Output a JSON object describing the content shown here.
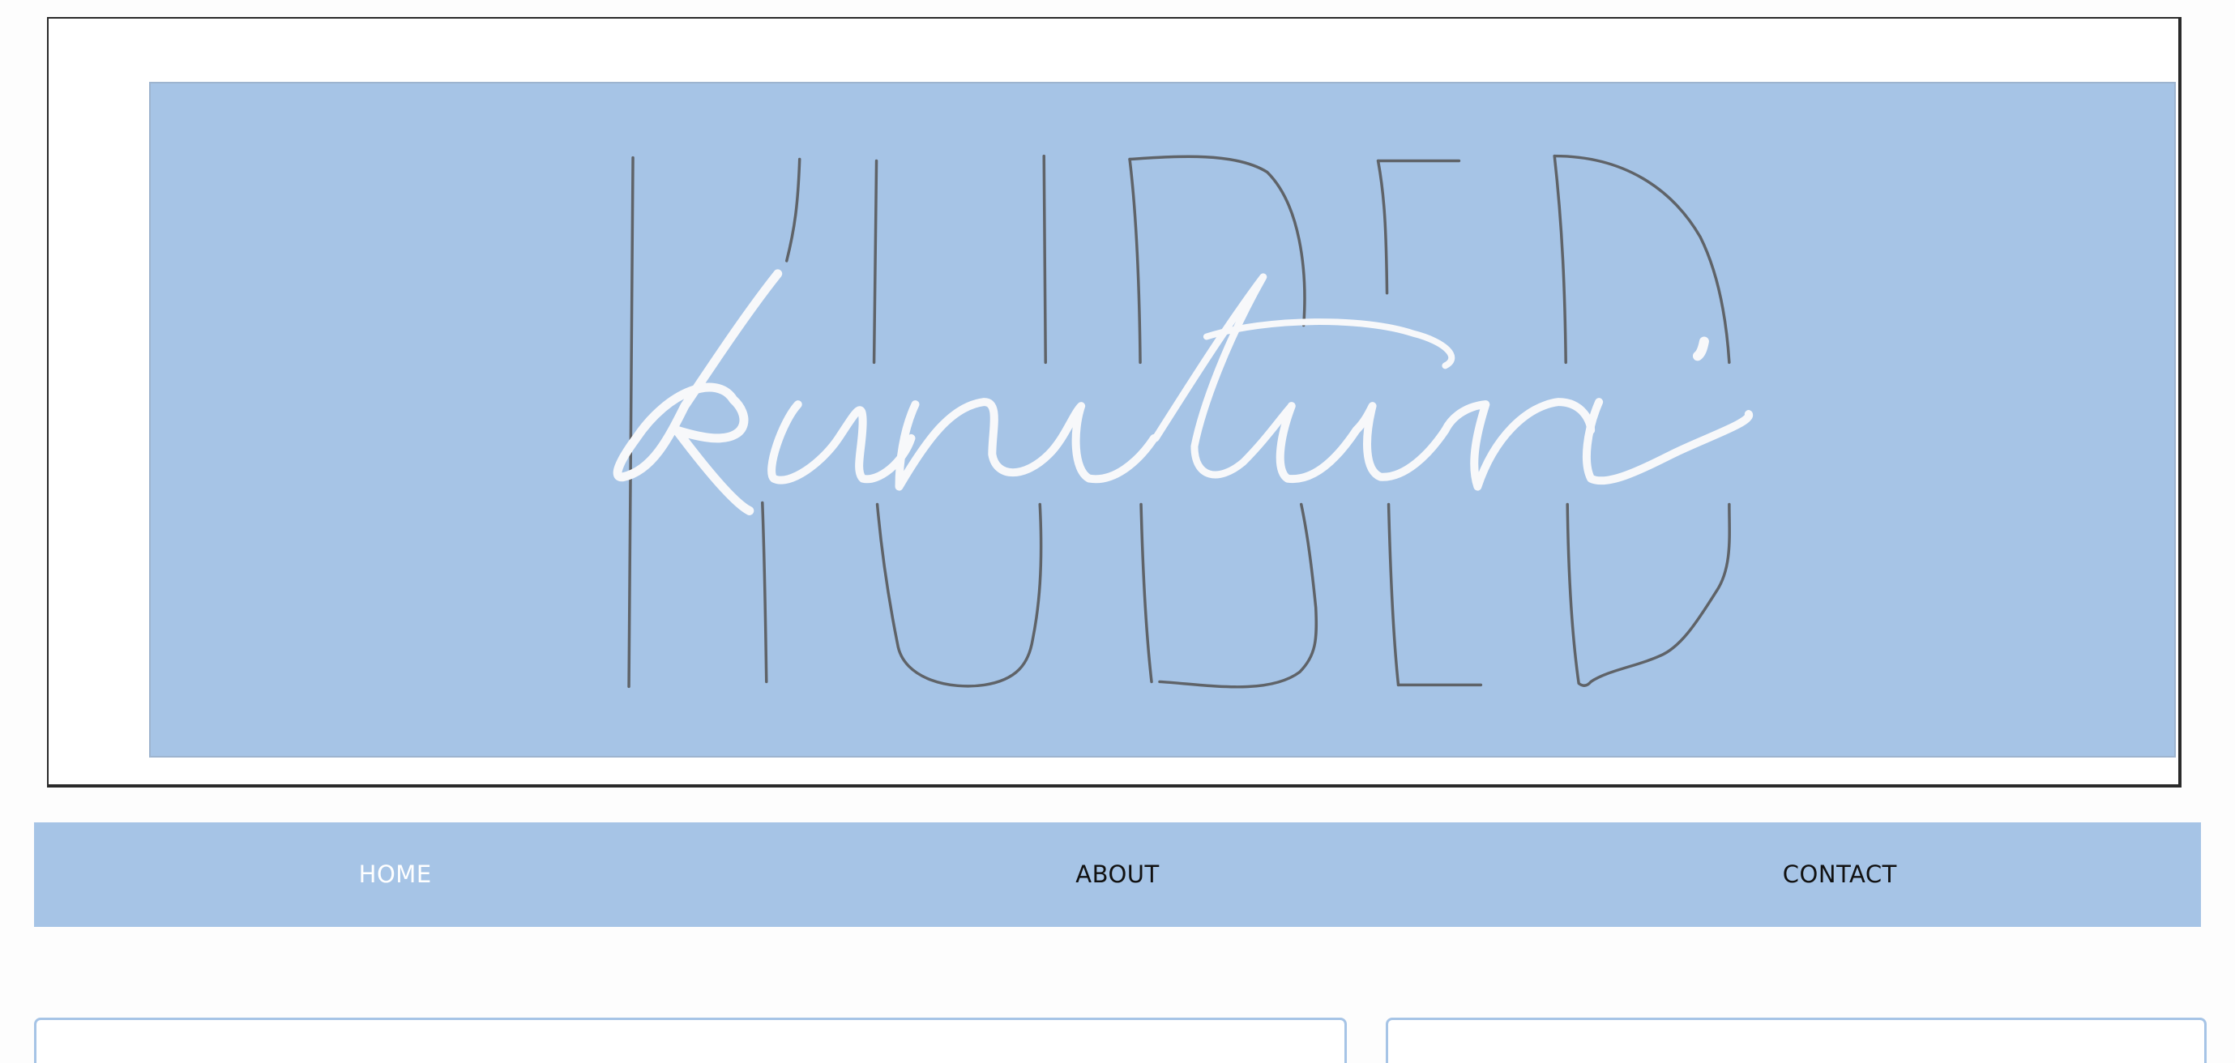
{
  "banner": {
    "logo_back_text": "KUBED",
    "logo_script_text": "karuturi",
    "background_color": "#a6c4e6",
    "outline_color": "#5a5f66",
    "script_color": "#ffffff"
  },
  "nav": {
    "items": [
      {
        "label": "HOME",
        "active": true
      },
      {
        "label": "ABOUT",
        "active": false
      },
      {
        "label": "CONTACT",
        "active": false
      }
    ],
    "background_color": "#a6c4e6",
    "active_text_color": "#ffffff",
    "text_color": "#111111"
  },
  "content": {
    "card_border_color": "#a6c4e6"
  }
}
